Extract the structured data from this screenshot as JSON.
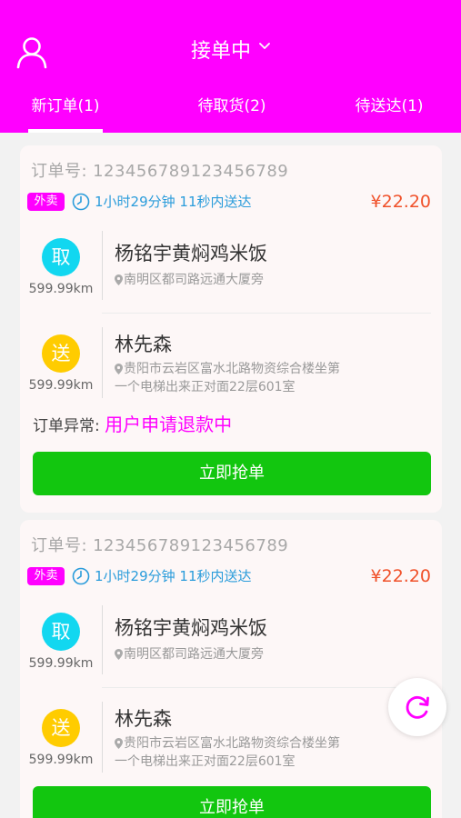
{
  "header": {
    "title": "接单中",
    "icons": {
      "user": "user-icon",
      "dropdown": "chevron-down-icon"
    },
    "tabs": [
      {
        "label": "新订单(1)"
      },
      {
        "label": "待取货(2)"
      },
      {
        "label": "待送达(1)"
      }
    ]
  },
  "orders": [
    {
      "order_label": "订单号:",
      "order_no": "123456789123456789",
      "tag": "外卖",
      "delivery_time": "1小时29分钟 11秒内送达",
      "price": "¥22.20",
      "pickup": {
        "badge": "取",
        "distance": "599.99km",
        "name": "杨铭宇黄焖鸡米饭",
        "address": "南明区都司路远通大厦旁"
      },
      "dropoff": {
        "badge": "送",
        "distance": "599.99km",
        "name": "林先森",
        "address_line1": "贵阳市云岩区富水北路物资综合楼坐第",
        "address_line2": "一个电梯出来正对面22层601室"
      },
      "exception_label": "订单异常:",
      "exception_value": "用户申请退款中",
      "button": "立即抢单"
    },
    {
      "order_label": "订单号:",
      "order_no": "123456789123456789",
      "tag": "外卖",
      "delivery_time": "1小时29分钟 11秒内送达",
      "price": "¥22.20",
      "pickup": {
        "badge": "取",
        "distance": "599.99km",
        "name": "杨铭宇黄焖鸡米饭",
        "address": "南明区都司路远通大厦旁"
      },
      "dropoff": {
        "badge": "送",
        "distance": "599.99km",
        "name": "林先森",
        "address_line1": "贵阳市云岩区富水北路物资综合楼坐第",
        "address_line2": "一个电梯出来正对面22层601室"
      },
      "button": "立即抢单"
    }
  ],
  "colors": {
    "brand": "#ff00ff",
    "pickup_badge": "#12d7f0",
    "dropoff_badge": "#ffcc00",
    "price": "#f0512a",
    "time": "#2a9cdb",
    "button": "#12c60f"
  },
  "fab": {
    "icon": "refresh-icon"
  }
}
